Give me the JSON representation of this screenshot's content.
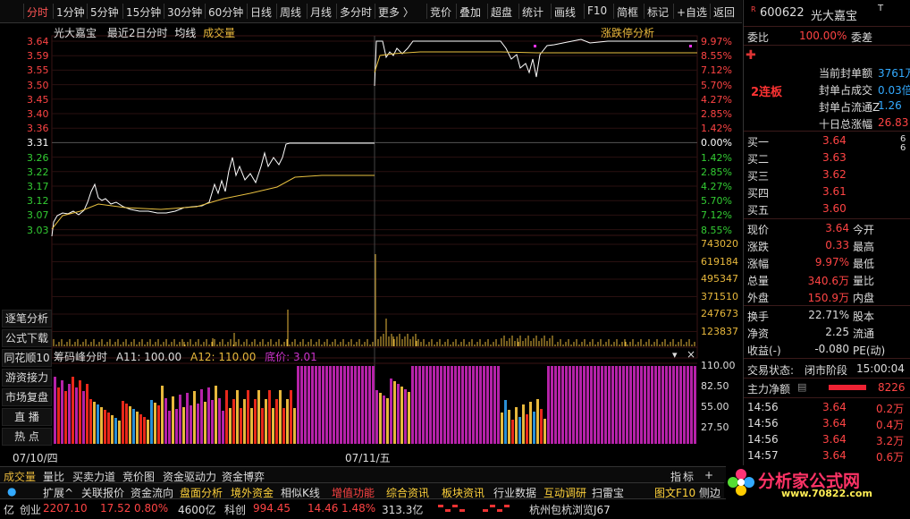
{
  "toolbar": {
    "items": [
      "分时",
      "1分钟",
      "5分钟",
      "15分钟",
      "30分钟",
      "60分钟",
      "日线",
      "周线",
      "月线",
      "多分时",
      "更多 〉",
      "竞价",
      "叠加",
      "超盘",
      "统计",
      "画线",
      "F10",
      "简框",
      "标记",
      "+自选",
      "返回"
    ]
  },
  "chart_header": {
    "stock_name": "光大嘉宝",
    "range_label": "最近2日分时",
    "legend_avg": "均线",
    "legend_vol": "成交量",
    "limit_analysis": "涨跌停分析"
  },
  "left_buttons": [
    "逐笔分析",
    "公式下载",
    "同花顺10",
    "游资接力",
    "市场复盘",
    "直  播",
    "热  点"
  ],
  "price_axis": {
    "left": [
      {
        "v": "3.64",
        "c": "red"
      },
      {
        "v": "3.59",
        "c": "red"
      },
      {
        "v": "3.55",
        "c": "red"
      },
      {
        "v": "3.50",
        "c": "red"
      },
      {
        "v": "3.45",
        "c": "red"
      },
      {
        "v": "3.40",
        "c": "red"
      },
      {
        "v": "3.36",
        "c": "red"
      },
      {
        "v": "3.31",
        "c": "white"
      },
      {
        "v": "3.26",
        "c": "green"
      },
      {
        "v": "3.22",
        "c": "green"
      },
      {
        "v": "3.17",
        "c": "green"
      },
      {
        "v": "3.12",
        "c": "green"
      },
      {
        "v": "3.07",
        "c": "green"
      },
      {
        "v": "3.03",
        "c": "green"
      }
    ],
    "right": [
      {
        "v": "9.97%",
        "c": "red"
      },
      {
        "v": "8.55%",
        "c": "red"
      },
      {
        "v": "7.12%",
        "c": "red"
      },
      {
        "v": "5.70%",
        "c": "red"
      },
      {
        "v": "4.27%",
        "c": "red"
      },
      {
        "v": "2.85%",
        "c": "red"
      },
      {
        "v": "1.42%",
        "c": "red"
      },
      {
        "v": "0.00%",
        "c": "white"
      },
      {
        "v": "1.42%",
        "c": "green"
      },
      {
        "v": "2.85%",
        "c": "green"
      },
      {
        "v": "4.27%",
        "c": "green"
      },
      {
        "v": "5.70%",
        "c": "green"
      },
      {
        "v": "7.12%",
        "c": "green"
      },
      {
        "v": "8.55%",
        "c": "green"
      }
    ]
  },
  "volume_axis": [
    "743020",
    "619184",
    "495347",
    "371510",
    "247673",
    "123837"
  ],
  "chip_panel": {
    "title": "筹码峰分时",
    "a11": "A11: 100.00",
    "a12": "A12: 110.00",
    "bottom_price": "底价: 3.01",
    "axis": [
      "110.00",
      "82.50",
      "55.00",
      "27.50"
    ]
  },
  "date_axis": [
    "07/10/四",
    "07/11/五"
  ],
  "bottom_tabs": {
    "items": [
      "成交量",
      "量比",
      "买卖力道",
      "竞价图",
      "资金驱动力",
      "资金博弈"
    ],
    "right_items": [
      "指",
      "标"
    ]
  },
  "bottom_nav": [
    "扩展^",
    "关联报价",
    "资金流向",
    "盘面分析",
    "境外资金",
    "相似K线",
    "增值功能",
    "综合资讯",
    "板块资讯",
    "行业数据",
    "互动调研",
    "扫雷宝",
    "图文F10",
    "侧边"
  ],
  "status_bar": {
    "items": [
      {
        "t": "亿",
        "c": "#ddd"
      },
      {
        "t": "创业",
        "c": "#ddd"
      },
      {
        "t": "2207.10",
        "c": "#ff4444"
      },
      {
        "t": "17.52",
        "c": "#ff4444"
      },
      {
        "t": "0.80%",
        "c": "#ff4444"
      },
      {
        "t": "4600亿",
        "c": "#ddd"
      },
      {
        "t": "科创",
        "c": "#ddd"
      },
      {
        "t": "994.45",
        "c": "#ff4444"
      },
      {
        "t": "14.46",
        "c": "#ff4444"
      },
      {
        "t": "1.48%",
        "c": "#ff4444"
      },
      {
        "t": "313.3亿",
        "c": "#ddd"
      },
      {
        "t": "杭州包杭浏览J67",
        "c": "#ddd"
      }
    ]
  },
  "quote": {
    "code": "600622",
    "name": "光大嘉宝",
    "weibi_label": "委比",
    "weibi_value": "100.00%",
    "weicha_label": "委差",
    "seal_labels": [
      "当前封单额",
      "封单占成交",
      "封单占流通Z",
      "十日总涨幅"
    ],
    "seal_values": [
      "3761万",
      "0.03倍",
      "1.26",
      "26.83"
    ],
    "lianban": "2连板",
    "buy_labels": [
      "买一",
      "买二",
      "买三",
      "买四",
      "买五"
    ],
    "buy_prices": [
      "3.64",
      "3.63",
      "3.62",
      "3.61",
      "3.60"
    ],
    "stats": [
      {
        "l": "现价",
        "v": "3.64",
        "l2": "今开"
      },
      {
        "l": "涨跌",
        "v": "0.33",
        "l2": "最高"
      },
      {
        "l": "涨幅",
        "v": "9.97%",
        "l2": "最低"
      },
      {
        "l": "总量",
        "v": "340.6万",
        "l2": "量比"
      },
      {
        "l": "外盘",
        "v": "150.9万",
        "l2": "内盘"
      }
    ],
    "stats2": [
      {
        "l": "换手",
        "v": "22.71%",
        "l2": "股本"
      },
      {
        "l": "净资",
        "v": "2.25",
        "l2": "流通"
      },
      {
        "l": "收益(-)",
        "v": "-0.080",
        "l2": "PE(动)"
      }
    ],
    "trade_state_label": "交易状态:",
    "trade_state": "闭市阶段",
    "trade_time": "15:00:04",
    "main_net_label": "主力净额",
    "main_net_value": "8226",
    "ticks": [
      {
        "t": "14:56",
        "p": "3.64",
        "v": "0.2万"
      },
      {
        "t": "14:56",
        "p": "3.64",
        "v": "0.4万"
      },
      {
        "t": "14:56",
        "p": "3.64",
        "v": "3.2万"
      },
      {
        "t": "14:57",
        "p": "3.64",
        "v": "0.6万"
      }
    ],
    "watermark": "分析家公式网",
    "watermark_url": "www.70822.com"
  }
}
